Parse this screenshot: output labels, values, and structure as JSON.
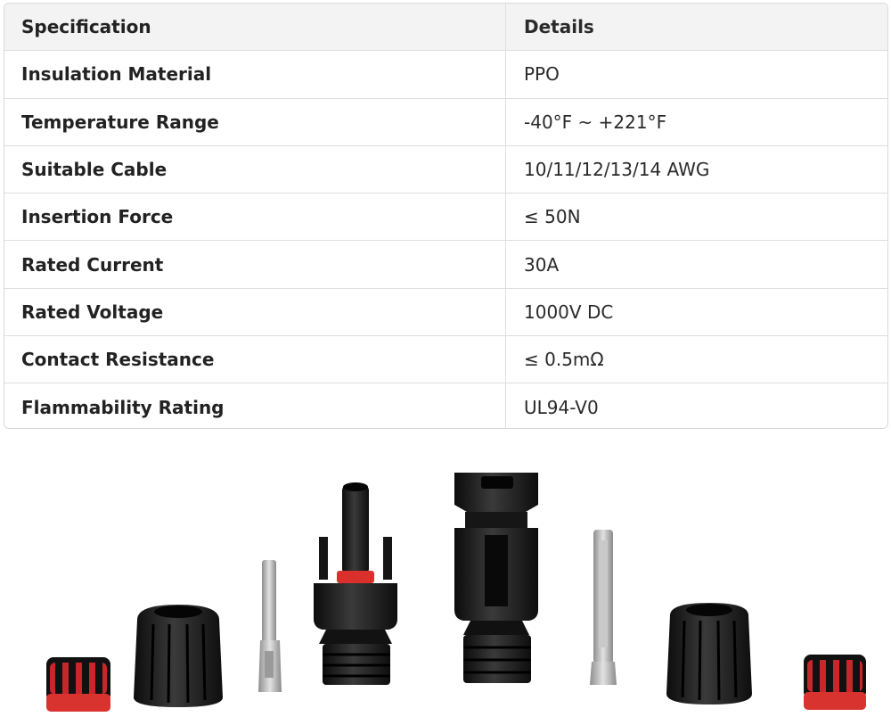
{
  "table": {
    "headers": [
      "Specification",
      "Details"
    ],
    "rows": [
      [
        "Insulation Material",
        "PPO"
      ],
      [
        "Temperature Range",
        "-40°F ~ +221°F"
      ],
      [
        "Suitable Cable",
        "10/11/12/13/14 AWG"
      ],
      [
        "Insertion Force",
        "≤ 50N"
      ],
      [
        "Rated Current",
        "30A"
      ],
      [
        "Rated Voltage",
        "1000V DC"
      ],
      [
        "Contact Resistance",
        "≤ 0.5mΩ"
      ],
      [
        "Flammability Rating",
        "UL94-V0"
      ]
    ]
  },
  "colors": {
    "connector_body": "#1a1a1a",
    "seal_red": "#d92b2b",
    "metal_pin": "#b8b8b8"
  }
}
